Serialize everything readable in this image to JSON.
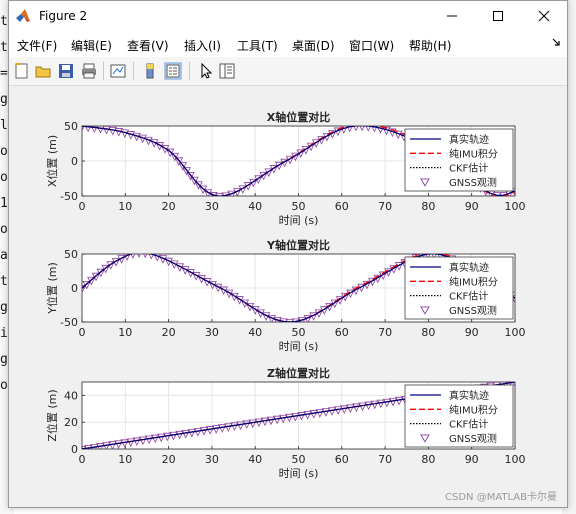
{
  "window": {
    "title": "Figure 2",
    "buttons": {
      "minimize": "minimize-icon",
      "maximize": "maximize-icon",
      "close": "close-icon"
    }
  },
  "menu": {
    "items": [
      "文件(F)",
      "编辑(E)",
      "查看(V)",
      "插入(I)",
      "工具(T)",
      "桌面(D)",
      "窗口(W)",
      "帮助(H)"
    ]
  },
  "toolbar": {
    "icons": [
      "new-figure-icon",
      "open-file-icon",
      "save-icon",
      "print-icon",
      "link-plot-icon",
      "colorbar-icon",
      "legend-icon",
      "pointer-icon",
      "property-inspector-icon"
    ]
  },
  "colors": {
    "true_track": "#00007f",
    "imu": "#ff0000",
    "ckf": "#000000",
    "gnss": "#8b3fa0"
  },
  "chart_data": [
    {
      "type": "line",
      "title": "X轴位置对比",
      "xlabel": "时间 (s)",
      "ylabel": "X位置 (m)",
      "xlim": [
        0,
        100
      ],
      "ylim": [
        -50,
        50
      ],
      "xticks": [
        0,
        10,
        20,
        30,
        40,
        50,
        60,
        70,
        80,
        90,
        100
      ],
      "yticks": [
        -50,
        0,
        50
      ],
      "grid": true,
      "legend_position": "top-right",
      "x": [
        0,
        10,
        20,
        31.4,
        47,
        63,
        80,
        94,
        100
      ],
      "series": [
        {
          "name": "真实轨迹",
          "style": "solid",
          "values": [
            50,
            40.5,
            15,
            -50,
            -0.5,
            50,
            20,
            -45,
            -43
          ]
        },
        {
          "name": "纯IMU积分",
          "style": "dashed",
          "values": [
            50,
            40.5,
            15,
            -50,
            0,
            52,
            22,
            -47,
            -44
          ]
        },
        {
          "name": "CKF估计",
          "style": "dotted",
          "values": [
            50,
            40.5,
            15,
            -50,
            -0.5,
            50,
            20,
            -45,
            -43
          ]
        },
        {
          "name": "GNSS观测",
          "style": "marker",
          "values": [
            50,
            40.5,
            15,
            -50,
            -0.5,
            50,
            20,
            -45,
            -43
          ]
        }
      ]
    },
    {
      "type": "line",
      "title": "Y轴位置对比",
      "xlabel": "时间 (s)",
      "ylabel": "Y位置 (m)",
      "xlim": [
        0,
        100
      ],
      "ylim": [
        -50,
        50
      ],
      "xticks": [
        0,
        10,
        20,
        30,
        40,
        50,
        60,
        70,
        80,
        90,
        100
      ],
      "yticks": [
        -50,
        0,
        50
      ],
      "grid": true,
      "legend_position": "top-right",
      "x": [
        0,
        8,
        16,
        32,
        48,
        64,
        80,
        92,
        100
      ],
      "series": [
        {
          "name": "真实轨迹",
          "style": "solid",
          "values": [
            0,
            40,
            50,
            0,
            -50,
            0,
            50,
            20,
            -15
          ]
        },
        {
          "name": "纯IMU积分",
          "style": "dashed",
          "values": [
            0,
            40,
            50,
            0,
            -50,
            2,
            52,
            22,
            -15
          ]
        },
        {
          "name": "CKF估计",
          "style": "dotted",
          "values": [
            0,
            40,
            50,
            0,
            -50,
            0,
            50,
            20,
            -15
          ]
        },
        {
          "name": "GNSS观测",
          "style": "marker",
          "values": [
            0,
            40,
            50,
            0,
            -50,
            0,
            50,
            20,
            -15
          ]
        }
      ]
    },
    {
      "type": "line",
      "title": "Z轴位置对比",
      "xlabel": "时间 (s)",
      "ylabel": "Z位置 (m)",
      "xlim": [
        0,
        100
      ],
      "ylim": [
        0,
        50
      ],
      "xticks": [
        0,
        10,
        20,
        30,
        40,
        50,
        60,
        70,
        80,
        90,
        100
      ],
      "yticks": [
        0,
        20,
        40
      ],
      "grid": true,
      "legend_position": "top-right",
      "x": [
        0,
        20,
        40,
        60,
        80,
        100
      ],
      "series": [
        {
          "name": "真实轨迹",
          "style": "solid",
          "values": [
            0,
            10,
            20,
            30,
            40,
            50
          ]
        },
        {
          "name": "纯IMU积分",
          "style": "dashed",
          "values": [
            0,
            10,
            20,
            30,
            40,
            50
          ]
        },
        {
          "name": "CKF估计",
          "style": "dotted",
          "values": [
            0,
            10,
            20,
            30,
            40,
            50
          ]
        },
        {
          "name": "GNSS观测",
          "style": "marker",
          "values": [
            0,
            10,
            20,
            30,
            40,
            50
          ]
        }
      ]
    }
  ],
  "watermark": "CSDN @MATLAB卡尔曼"
}
